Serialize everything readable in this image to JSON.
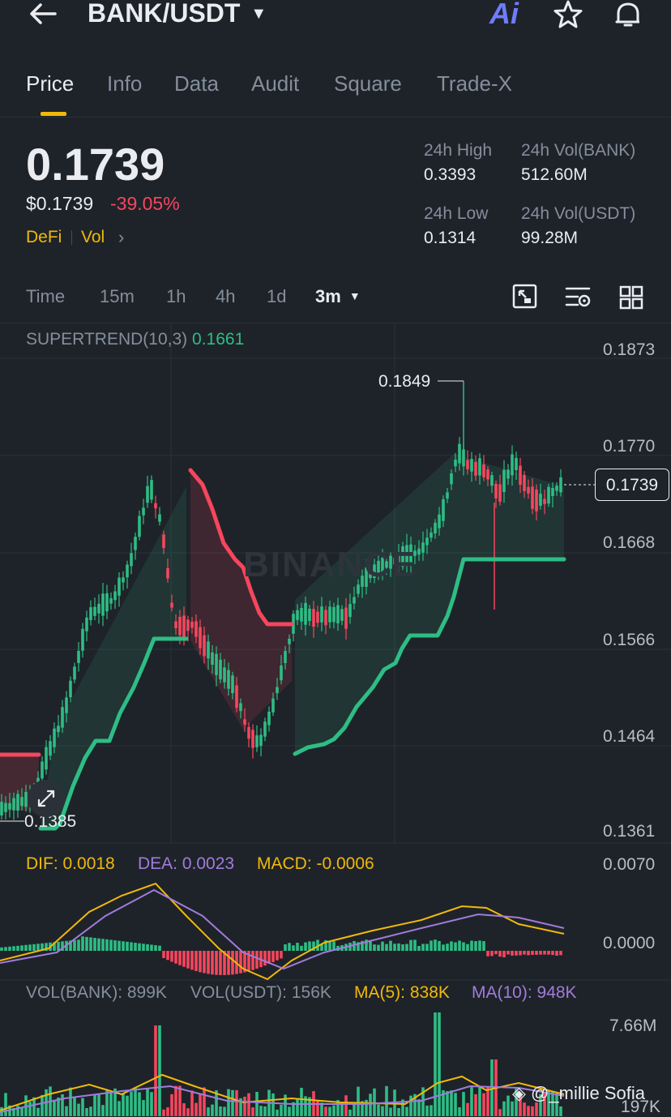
{
  "header": {
    "pair": "BANK/USDT",
    "ai_label": "Ai"
  },
  "tabs": [
    {
      "label": "Price",
      "active": true
    },
    {
      "label": "Info"
    },
    {
      "label": "Data"
    },
    {
      "label": "Audit"
    },
    {
      "label": "Square"
    },
    {
      "label": "Trade-X"
    }
  ],
  "price": {
    "last": "0.1739",
    "usd": "$0.1739",
    "change_pct": "-39.05%",
    "tag1": "DeFi",
    "tag2": "Vol"
  },
  "stats": {
    "high_label": "24h High",
    "high_value": "0.3393",
    "vol_base_label": "24h Vol(BANK)",
    "vol_base_value": "512.60M",
    "low_label": "24h Low",
    "low_value": "0.1314",
    "vol_quote_label": "24h Vol(USDT)",
    "vol_quote_value": "99.28M"
  },
  "intervals": [
    "Time",
    "15m",
    "1h",
    "4h",
    "1d"
  ],
  "interval_selected": "3m",
  "indicators": {
    "supertrend_label": "SUPERTREND(10,3)",
    "supertrend_value": "0.1661",
    "dif": "DIF: 0.0018",
    "dea": "DEA: 0.0023",
    "macd": "MACD: -0.0006",
    "vol_bank": "VOL(BANK): 899K",
    "vol_usdt": "VOL(USDT): 156K",
    "ma5": "MA(5): 838K",
    "ma10": "MA(10): 948K"
  },
  "colors": {
    "up": "#2ebd85",
    "down": "#f6465d",
    "accent": "#f0b90b",
    "ma10": "#a07cdb",
    "bg": "#1e2329"
  },
  "chart_data": {
    "type": "candlestick",
    "price_axis": [
      "0.1873",
      "0.1770",
      "0.1668",
      "0.1566",
      "0.1464",
      "0.1361"
    ],
    "high_label": "0.1849",
    "low_label": "0.1385",
    "current_price": "0.1739",
    "macd_axis": [
      "0.0070",
      "0.0000"
    ],
    "volume_axis": [
      "7.66M",
      "197K"
    ],
    "watermark": "BINANCE",
    "credit": "@_millie Sofia"
  }
}
